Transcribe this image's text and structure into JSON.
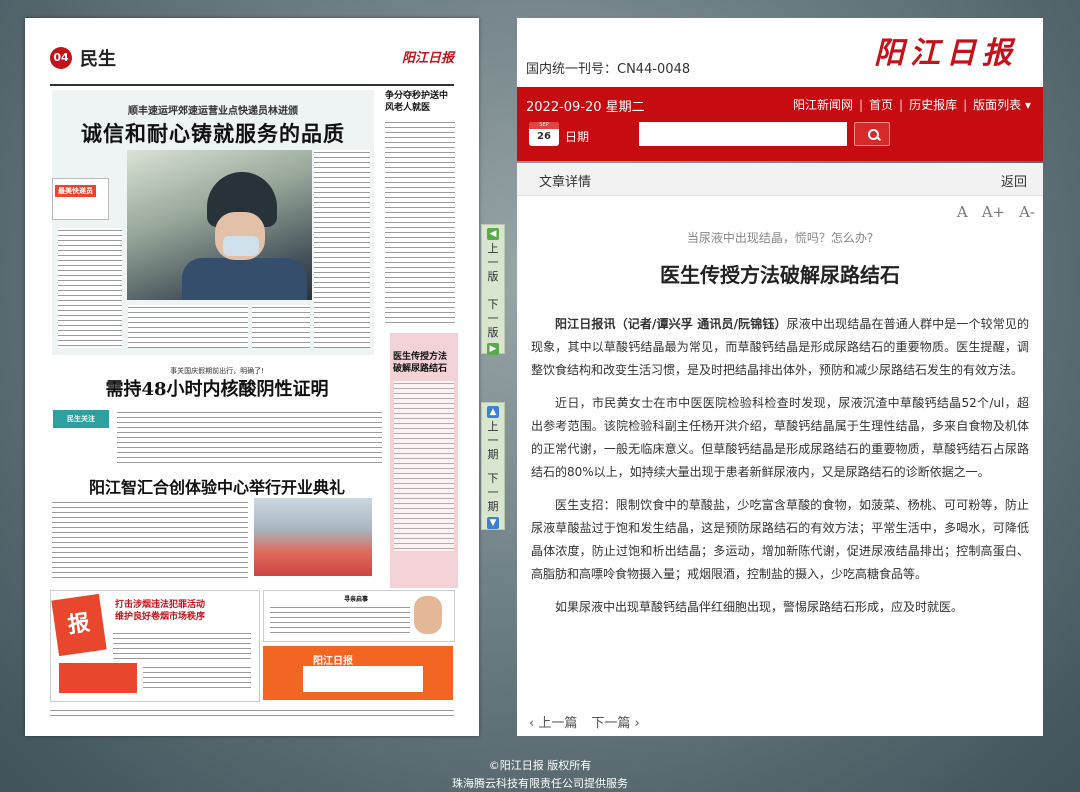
{
  "paper": {
    "page_number": "04",
    "section": "民生",
    "masthead": "阳江日报",
    "story1_kicker": "顺丰速运坪郊速运营业点快递员林进颁",
    "story1_headline": "诚信和耐心铸就服务的品质",
    "story1_badge": "最美快递员",
    "side_headline": "争分夺秒护送中风老人就医",
    "pink_headline": "医生传授方法破解尿路结石",
    "story2_kicker": "事关国庆假期前出行，明确了!",
    "story2_headline": "需持48小时内核酸阴性证明",
    "story2_tag": "民生关注",
    "story3_headline": "阳江智汇合创体验中心举行开业典礼",
    "ad_left_burst": "报",
    "ad_left_title": "打击涉烟违法犯罪活动\n维护良好卷烟市场秩序",
    "ad_mid_title": "寻亲启事",
    "ad_orange_masthead": "阳江日报"
  },
  "nav": {
    "prev_page": "上一版",
    "next_page": "下一版",
    "prev_issue": "上一期",
    "next_issue": "下一期"
  },
  "header": {
    "issn": "国内统一刊号：CN44-0048",
    "logo": "阳江日报",
    "date": "2022-09-20  星期二",
    "nav_items": [
      "阳江新闻网",
      "首页",
      "历史报库",
      "版面列表 ▾"
    ],
    "calendar_day": "26",
    "calendar_month": "SEP",
    "date_label": "日期",
    "search_placeholder": ""
  },
  "article": {
    "section_label": "文章详情",
    "back_label": "返回",
    "font_large": "A",
    "font_plus": "A+",
    "font_minus": "A-",
    "subtitle": "当尿液中出现结晶，慌吗？怎么办?",
    "title": "医生传授方法破解尿路结石",
    "byline": "阳江日报讯（记者/谭兴孚 通讯员/阮锦钰）",
    "p1": "尿液中出现结晶在普通人群中是一个较常见的现象，其中以草酸钙结晶最为常见，而草酸钙结晶是形成尿路结石的重要物质。医生提醒，调整饮食结构和改变生活习惯，是及时把结晶排出体外，预防和减少尿路结石发生的有效方法。",
    "p2": "近日，市民黄女士在市中医医院检验科检查时发现，尿液沉渣中草酸钙结晶52个/ul，超出参考范围。该院检验科副主任杨开洪介绍，草酸钙结晶属于生理性结晶，多来自食物及机体的正常代谢，一般无临床意义。但草酸钙结晶是形成尿路结石的重要物质，草酸钙结石占尿路结石的80%以上，如持续大量出现于患者新鲜尿液内，又是尿路结石的诊断依据之一。",
    "p3": "医生支招：限制饮食中的草酸盐，少吃富含草酸的食物，如菠菜、杨桃、可可粉等，防止尿液草酸盐过于饱和发生结晶，这是预防尿路结石的有效方法；平常生活中，多喝水，可降低晶体浓度，防止过饱和析出结晶；多运动，增加新陈代谢，促进尿液结晶排出；控制高蛋白、高脂肪和高嘌呤食物摄入量；戒烟限酒，控制盐的摄入，少吃高糖食品等。",
    "p4": "如果尿液中出现草酸钙结晶伴红细胞出现，警惕尿路结石形成，应及时就医。",
    "prev_article": "‹ 上一篇",
    "next_article": "下一篇 ›"
  },
  "footer": {
    "copyright": "©阳江日报 版权所有",
    "provider": "珠海腾云科技有限责任公司提供服务"
  },
  "colors": {
    "brand_red": "#c60c10",
    "nav_green": "#d8e6cf"
  }
}
